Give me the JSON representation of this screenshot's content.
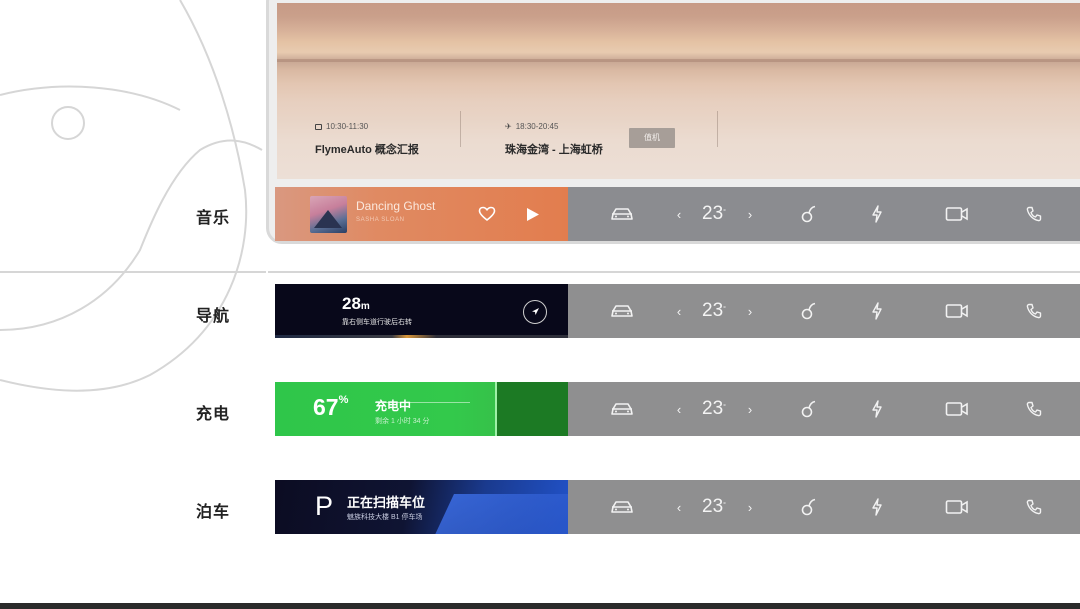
{
  "screen": {
    "events": [
      {
        "time": "10:30-11:30",
        "name": "FlymeAuto 概念汇报"
      },
      {
        "time": "18:30-20:45",
        "name": "珠海金湾 - 上海虹桥"
      }
    ],
    "checkin_label": "值机"
  },
  "rows": [
    {
      "label": "音乐",
      "music": {
        "song": "Dancing Ghost",
        "artist": "SASHA SLOAN"
      }
    },
    {
      "label": "导航",
      "nav": {
        "distance": "28",
        "unit": "m",
        "instruction": "靠右侧车道行驶后右转"
      }
    },
    {
      "label": "充电",
      "charge": {
        "percent": 67,
        "percent_text": "67",
        "unit": "%",
        "status": "充电中",
        "remaining": "剩余 1 小时 34 分"
      }
    },
    {
      "label": "泊车",
      "park": {
        "symbol": "P",
        "status": "正在扫描车位",
        "location": "魅族科技大楼 B1 停车场"
      }
    }
  ],
  "controls": {
    "temperature": "23",
    "degree": "°",
    "prev": "‹",
    "next": "›",
    "icons": [
      "car-icon",
      "fan-icon",
      "charge-bolt-icon",
      "camera-icon",
      "phone-icon"
    ]
  },
  "colors": {
    "music_card": "#e27d4e",
    "nav_card": "#08081a",
    "charge_card": "#33c94b",
    "park_card": "#2152c8",
    "controls_bg": "#8f8f90"
  }
}
